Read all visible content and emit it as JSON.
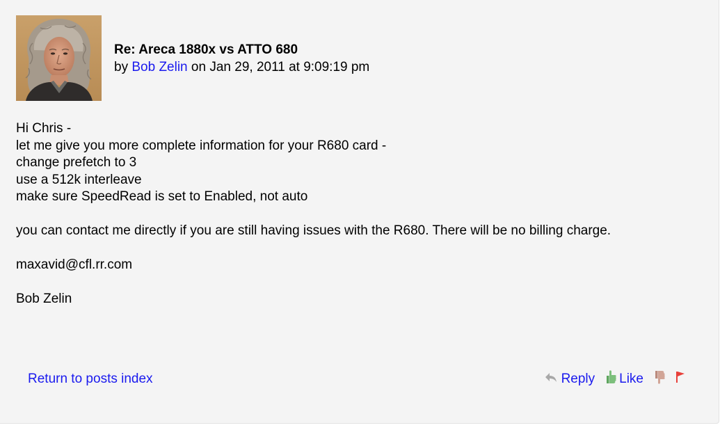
{
  "post": {
    "title": "Re: Areca 1880x vs ATTO 680",
    "by_prefix": "by",
    "author": "Bob Zelin",
    "date_text": "on Jan 29, 2011 at 9:09:19 pm",
    "body": {
      "line1": "Hi Chris -",
      "line2": "let me give you more complete information for your R680 card -",
      "line3": "change prefetch to 3",
      "line4": "use a 512k interleave",
      "line5": "make sure SpeedRead is set to Enabled, not auto",
      "line6": "you can contact me directly if you are still having issues with the R680. There will be no billing charge.",
      "line7": "maxavid@cfl.rr.com",
      "line8": "Bob Zelin"
    }
  },
  "footer": {
    "return_label": "Return to posts index",
    "reply_label": "Reply",
    "like_label": "Like"
  },
  "icons": {
    "reply": "reply-arrow-icon",
    "like": "thumbs-up-icon",
    "dislike": "thumbs-down-icon",
    "flag": "flag-icon"
  },
  "colors": {
    "link": "#1a1aee",
    "background": "#f4f4f4",
    "like_icon": "#6fb36f",
    "dislike_icon": "#c89a8e",
    "flag_icon": "#e8403a"
  }
}
